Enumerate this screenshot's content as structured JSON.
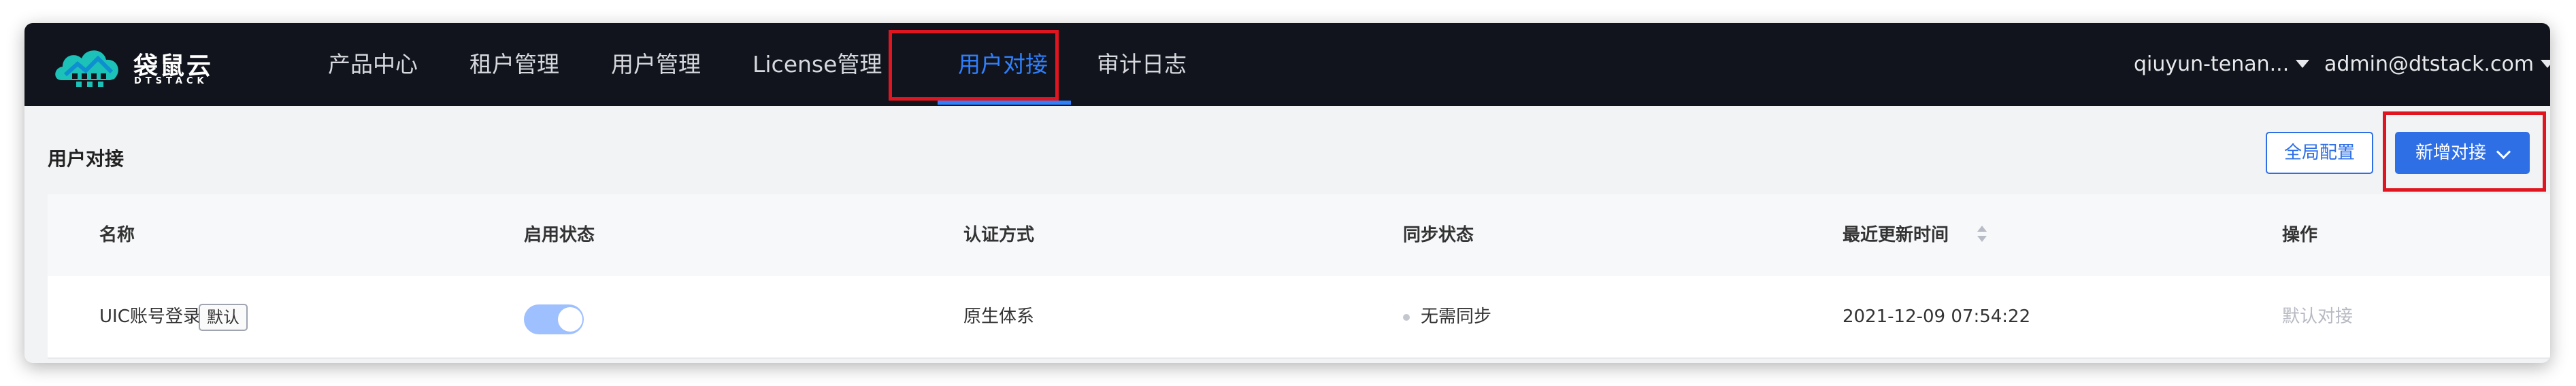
{
  "brand": {
    "name_cn": "袋鼠云",
    "name_en": "DTSTACK"
  },
  "nav": {
    "items": [
      {
        "label": "产品中心"
      },
      {
        "label": "租户管理"
      },
      {
        "label": "用户管理"
      },
      {
        "label": "License管理"
      },
      {
        "label": "用户对接",
        "active": true
      },
      {
        "label": "审计日志"
      }
    ],
    "tenant": "qiuyun-tenan...",
    "user": "admin@dtstack.com"
  },
  "page": {
    "title": "用户对接",
    "global_config_button": "全局配置",
    "add_button": "新增对接"
  },
  "table": {
    "columns": [
      "名称",
      "启用状态",
      "认证方式",
      "同步状态",
      "最近更新时间",
      "操作"
    ],
    "rows": [
      {
        "name": "UIC账号登录",
        "tag": "默认",
        "enabled": true,
        "auth_method": "原生体系",
        "sync_status": "无需同步",
        "updated_at": "2021-12-09 07:54:22",
        "action": "默认对接"
      }
    ]
  },
  "colors": {
    "accent": "#2f6fe6",
    "active_menu": "#2f80ff",
    "topbar": "#11141c",
    "highlight": "#e0151f"
  }
}
